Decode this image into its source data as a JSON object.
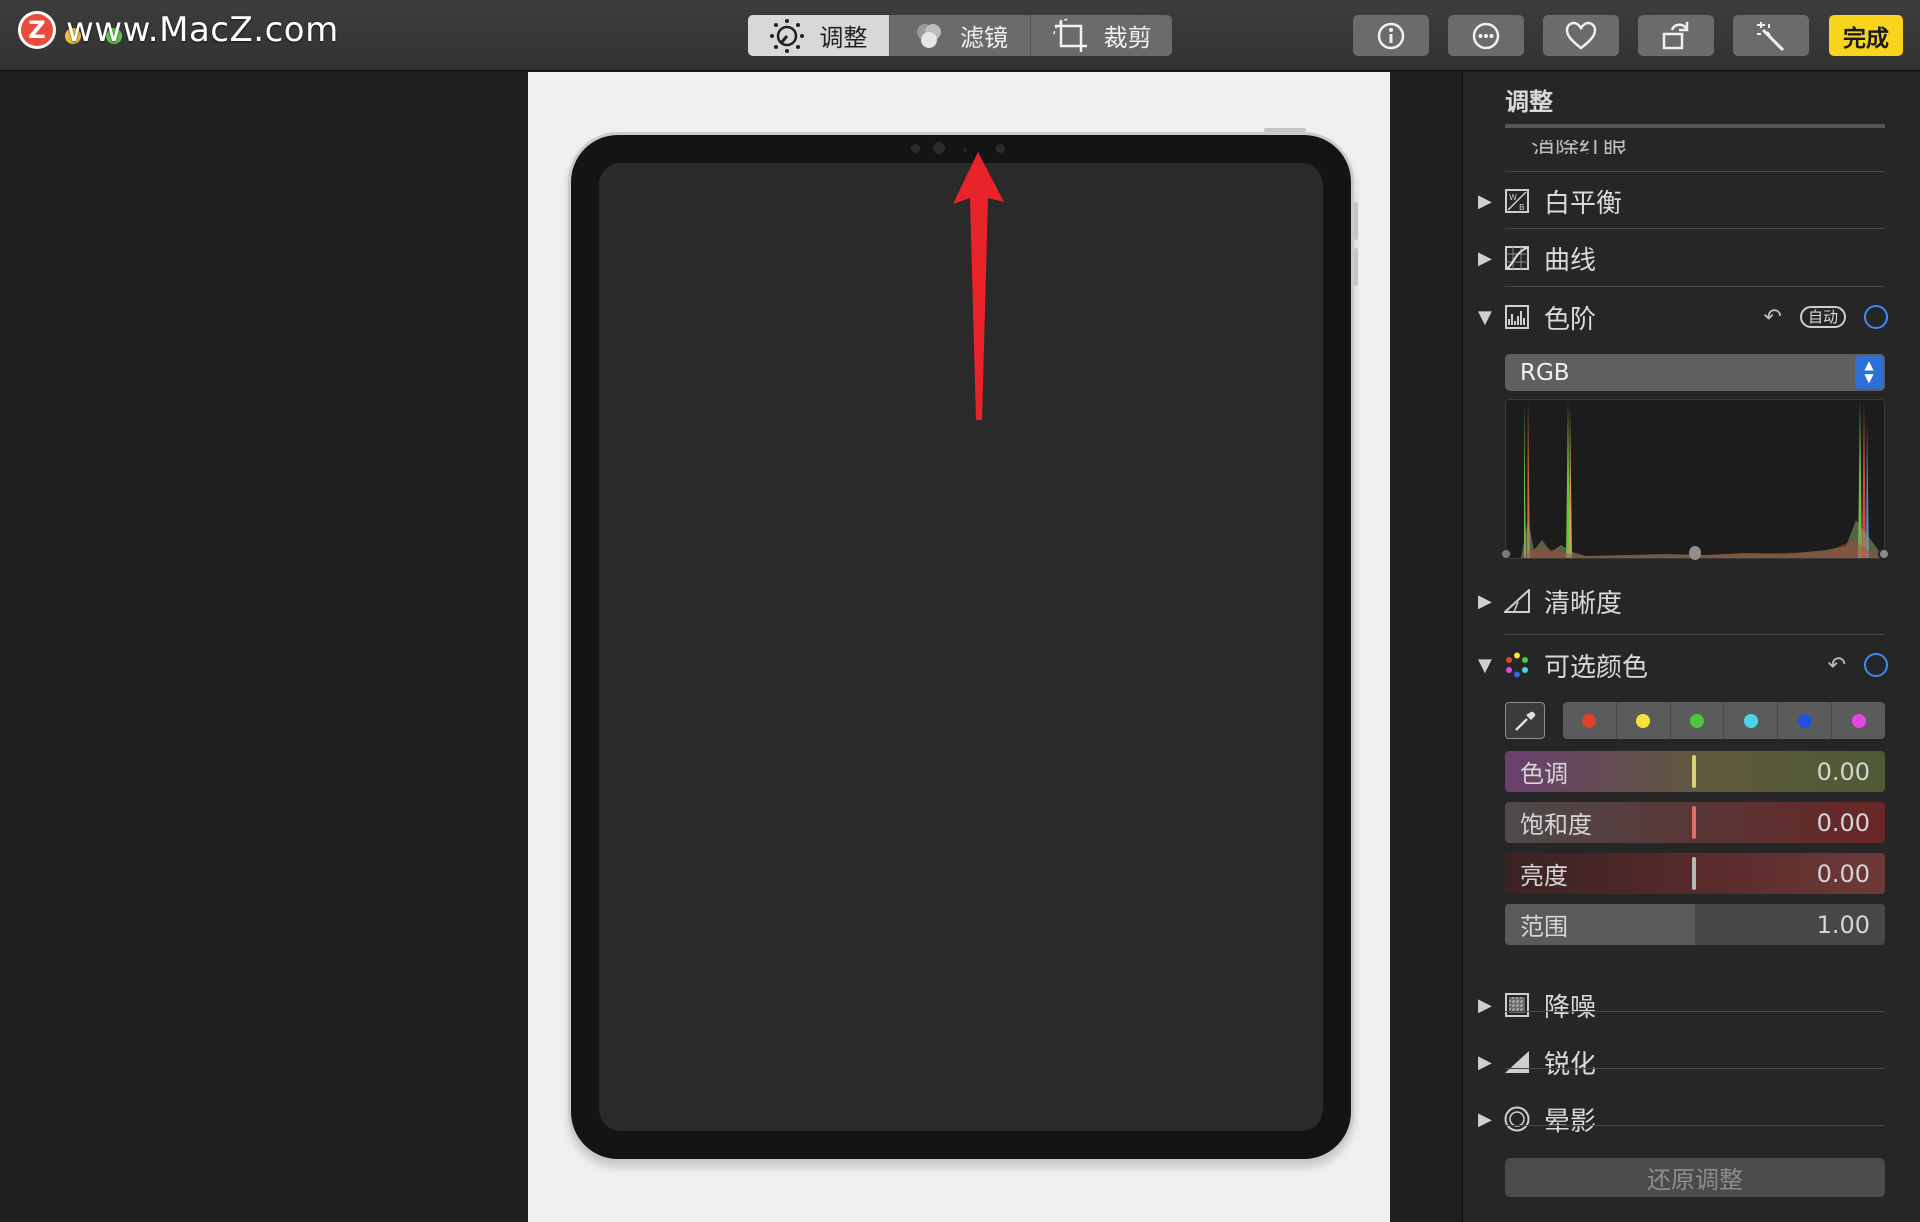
{
  "watermark": {
    "logo_letter": "Z",
    "text": "www.MacZ.com"
  },
  "toolbar": {
    "tabs": [
      {
        "label": "调整",
        "icon": "adjust-dial-icon",
        "active": true
      },
      {
        "label": "滤镜",
        "icon": "filters-icon",
        "active": false
      },
      {
        "label": "裁剪",
        "icon": "crop-icon",
        "active": false
      }
    ],
    "tools": [
      "info-icon",
      "more-icon",
      "heart-icon",
      "rotate-icon",
      "magic-wand-icon"
    ],
    "done_label": "完成"
  },
  "sidebar": {
    "title": "调整",
    "clipped_row_label": "消除红眼",
    "sections": {
      "white_balance": {
        "label": "白平衡",
        "expanded": false
      },
      "curves": {
        "label": "曲线",
        "expanded": false
      },
      "levels": {
        "label": "色阶",
        "expanded": true,
        "auto_label": "自动",
        "channel": "RGB"
      },
      "definition": {
        "label": "清晰度",
        "expanded": false
      },
      "selective_color": {
        "label": "可选颜色",
        "expanded": true
      },
      "noise_reduction": {
        "label": "降噪",
        "expanded": false
      },
      "sharpen": {
        "label": "锐化",
        "expanded": false
      },
      "vignette": {
        "label": "晕影",
        "expanded": false
      }
    },
    "swatches": [
      "#e2412f",
      "#f3e437",
      "#4bc642",
      "#48d6e6",
      "#2150e0",
      "#e447e6"
    ],
    "sliders": [
      {
        "label": "色调",
        "value": "0.00"
      },
      {
        "label": "饱和度",
        "value": "0.00"
      },
      {
        "label": "亮度",
        "value": "0.00"
      },
      {
        "label": "范围",
        "value": "1.00"
      }
    ],
    "reset_label": "还原调整"
  },
  "colors": {
    "accent_blue": "#3b8cf4",
    "done_yellow": "#f8d41c",
    "arrow_red": "#e8242a"
  }
}
